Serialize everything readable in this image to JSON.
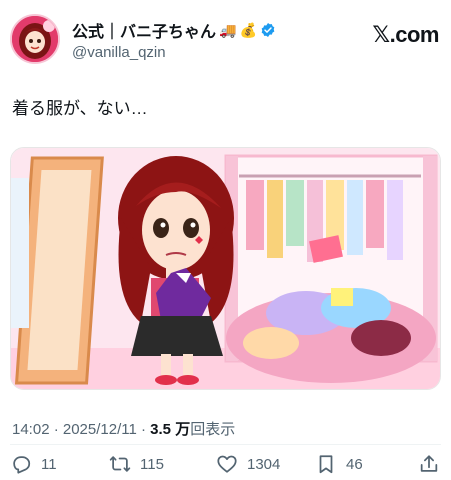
{
  "author": {
    "display_name": "公式｜バニ子ちゃん",
    "name_emojis": [
      "🚚",
      "💰"
    ],
    "handle": "@vanilla_qzin",
    "verified": true,
    "avatar_label": "Vanilla"
  },
  "site_label": "𝕏.com",
  "tweet": {
    "text": "着る服が、ない…"
  },
  "media": {
    "kind": "illustration"
  },
  "meta": {
    "time": "14:02 · 2025/12/11 · ",
    "views_value": "3.5 万",
    "views_label": "回表示"
  },
  "actions": {
    "replies": "11",
    "reposts": "115",
    "likes": "1304",
    "bookmarks": "46"
  },
  "colors": {
    "text": "#0f1419",
    "secondary": "#536471",
    "verified": "#1d9bf0",
    "accent_pink": "#ff6fa5"
  },
  "icons": {
    "verified": "verified-badge-icon",
    "reply": "reply-icon",
    "repost": "repost-icon",
    "like": "heart-icon",
    "bookmark": "bookmark-icon",
    "share": "share-icon"
  }
}
